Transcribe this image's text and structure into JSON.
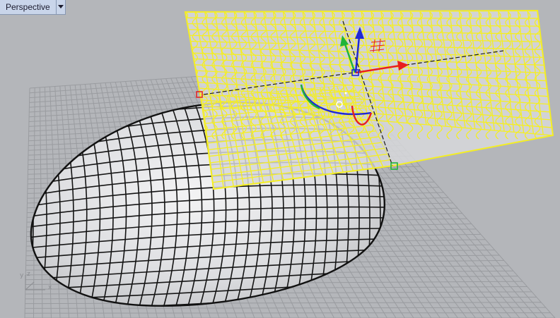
{
  "viewport": {
    "title": "Perspective",
    "menu_icon": "chevron-down-icon"
  },
  "axis_indicator": {
    "y_label": "y",
    "z_label": "z",
    "x_label": "x"
  },
  "colors": {
    "background": "#b4b6ba",
    "grid_line": "#9a9ca0",
    "surface_fill": "#dcdde0",
    "selection_yellow": "#f4ee23",
    "gumball_x": "#e81e1e",
    "gumball_y": "#1fb43a",
    "gumball_z": "#1f27d6"
  }
}
